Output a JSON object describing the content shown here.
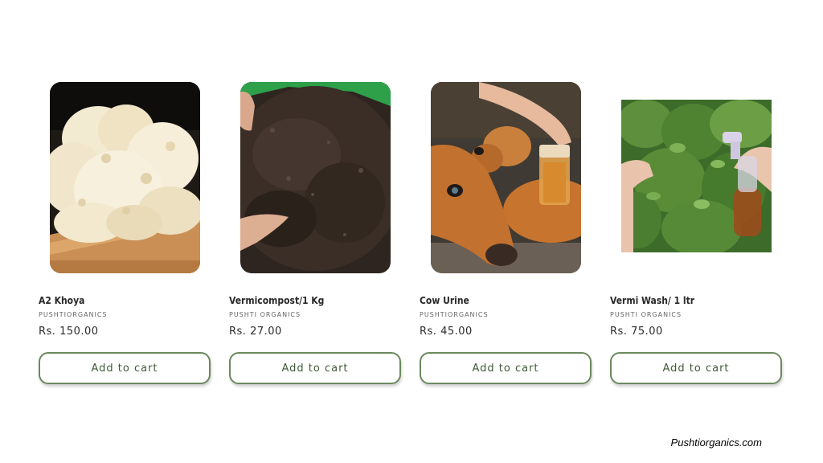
{
  "products": [
    {
      "title": "A2 Khoya",
      "vendor": "PUSHTIORGANICS",
      "price": "Rs. 150.00",
      "button_label": "Add to cart",
      "image": "khoya-image"
    },
    {
      "title": "Vermicompost/1 Kg",
      "vendor": "PUSHTI ORGANICS",
      "price": "Rs. 27.00",
      "button_label": "Add to cart",
      "image": "vermicompost-image"
    },
    {
      "title": "Cow Urine",
      "vendor": "PUSHTIORGANICS",
      "price": "Rs. 45.00",
      "button_label": "Add to cart",
      "image": "cow-urine-image"
    },
    {
      "title": "Vermi Wash/ 1 ltr",
      "vendor": "PUSHTI ORGANICS",
      "price": "Rs. 75.00",
      "button_label": "Add to cart",
      "image": "vermi-wash-image"
    }
  ],
  "footer": {
    "website": "Pushtiorganics.com"
  },
  "colors": {
    "button_border": "#6b8a5e",
    "button_text": "#3f5a36",
    "title_text": "#2a2a2a",
    "vendor_text": "#666666"
  }
}
